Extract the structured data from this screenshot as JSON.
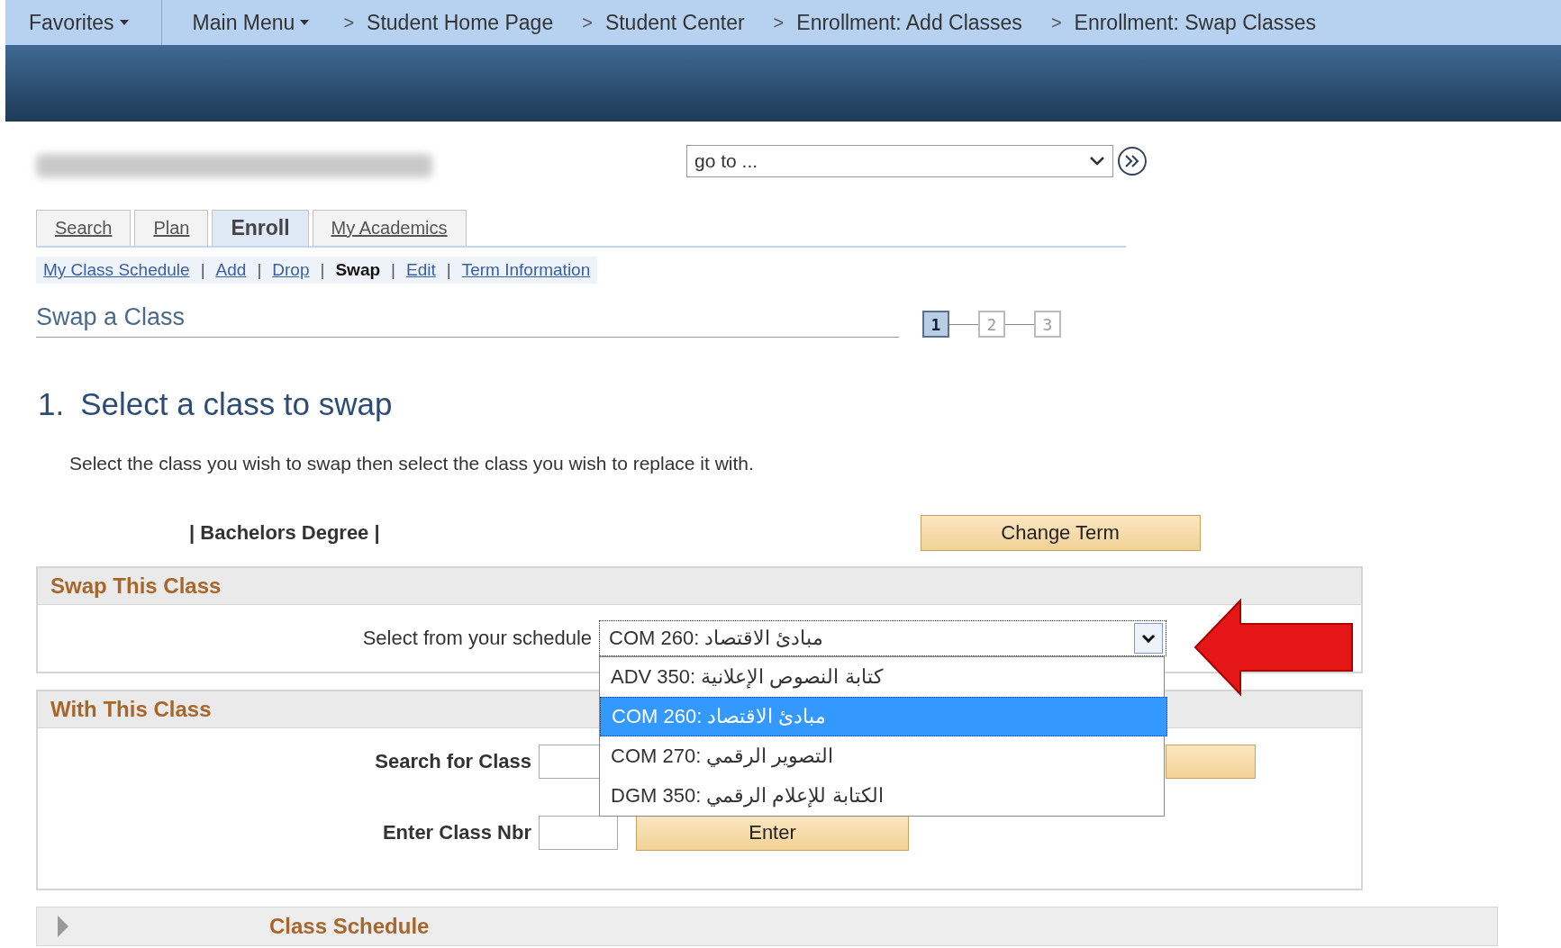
{
  "nav": [
    {
      "label": "Favorites",
      "kind": "menu"
    },
    {
      "label": "Main Menu",
      "kind": "menu"
    },
    {
      "label": "Student Home Page",
      "kind": "crumb",
      "prefix": ">"
    },
    {
      "label": "Student Center",
      "kind": "crumb",
      "prefix": ">"
    },
    {
      "label": "Enrollment: Add Classes",
      "kind": "crumb",
      "prefix": ">"
    },
    {
      "label": "Enrollment: Swap Classes",
      "kind": "crumb",
      "prefix": ">"
    }
  ],
  "goto": {
    "value": "go to ..."
  },
  "tabs": [
    {
      "label": "Search",
      "selected": false
    },
    {
      "label": "Plan",
      "selected": false
    },
    {
      "label": "Enroll",
      "selected": true
    },
    {
      "label": "My Academics",
      "selected": false
    }
  ],
  "subnav": [
    {
      "label": "My Class Schedule",
      "selected": false
    },
    {
      "separator": "|",
      "label": "Add",
      "selected": false
    },
    {
      "separator": "|",
      "label": "Drop",
      "selected": false
    },
    {
      "separator": "|",
      "label": "Swap",
      "selected": true
    },
    {
      "separator": "|",
      "label": "Edit",
      "selected": false
    },
    {
      "separator": "|",
      "label": "Term Information",
      "selected": false
    }
  ],
  "page_title": "Swap a Class",
  "steps": [
    {
      "label": "1",
      "selected": true
    },
    {
      "label": "2",
      "selected": false
    },
    {
      "label": "3",
      "selected": false
    }
  ],
  "heading": {
    "number": "1.",
    "text": "Select a class to swap"
  },
  "instructions": "Select the class you wish to swap then select the class you wish to replace it with.",
  "career": "| Bachelors Degree |",
  "change_term_button": "Change Term",
  "swap_panel": {
    "title": "Swap This Class",
    "select_label": "Select from your schedule",
    "select_value": "COM 260: مبادئ الاقتصاد",
    "expanded": true,
    "options": [
      {
        "label": "ADV 350: كتابة النصوص الإعلانية",
        "selected": false
      },
      {
        "label": "COM 260: مبادئ الاقتصاد",
        "selected": true
      },
      {
        "label": "COM 270: التصوير الرقمي",
        "selected": false
      },
      {
        "label": "DGM 350: الكتابة للإعلام الرقمي",
        "selected": false
      }
    ]
  },
  "with_panel": {
    "title": "With This Class",
    "search_label": "Search for Class",
    "class_nbr_label": "Enter Class Nbr",
    "enter_button": "Enter"
  },
  "class_schedule": {
    "title": "Class Schedule",
    "expanded": false
  }
}
